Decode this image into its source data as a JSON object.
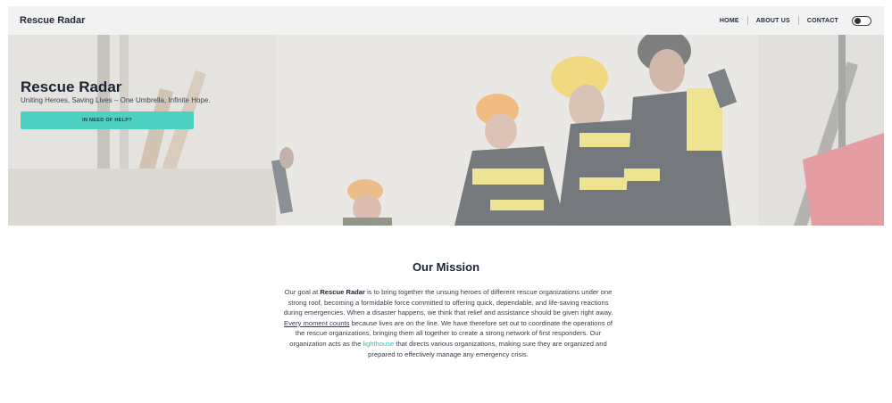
{
  "navbar": {
    "brand": "Rescue Radar",
    "links": [
      "HOME",
      "ABOUT US",
      "CONTACT"
    ]
  },
  "hero": {
    "title": "Rescue Radar",
    "subtitle": "Uniting Heroes, Saving Lives – One Umbrella, Infinite Hope.",
    "button_label": "IN NEED OF HELP?"
  },
  "mission": {
    "title": "Our Mission",
    "p1": "Our goal at ",
    "brand": "Rescue Radar",
    "p2": " is to bring together the unsung heroes of different rescue organizations under one strong roof, becoming a formidable force committed to offering quick, dependable, and life-saving reactions during emergencies. When a disaster happens, we think that relief and assistance should be given right away. ",
    "underline": "Every moment counts",
    "p3": " because lives are on the line. We have therefore set out to coordinate the operations of the rescue organizations, bringing them all together to create a strong network of first responders. Our organization acts as the ",
    "highlight": "lighthouse",
    "p4": " that directs various organizations, making sure they are organized and prepared to effectively manage any emergency crisis."
  },
  "colors": {
    "accent": "#4dd0c2",
    "navbar_bg": "#f2f2f2",
    "text_dark": "#1a2433",
    "highlight": "#38c1b2"
  },
  "icons": {
    "toggle": "theme-toggle-switch"
  }
}
